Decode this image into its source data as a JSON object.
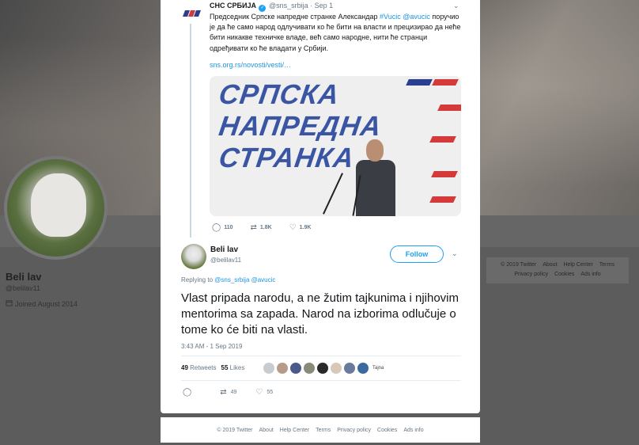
{
  "profile": {
    "name": "Beli lav",
    "handle": "@belilav11",
    "joined": "Joined August 2014"
  },
  "right_footer": {
    "row1": [
      "© 2019 Twitter",
      "About",
      "Help Center",
      "Terms"
    ],
    "row2": [
      "Privacy policy",
      "Cookies",
      "Ads info"
    ]
  },
  "quoted_tweet": {
    "name": "СНС СРБИЈА",
    "handle": "@sns_srbija",
    "separator": "·",
    "date": "Sep 1",
    "text_before": "Председник Српске напредне странке Александар ",
    "hashtag": "#Vucic",
    "mention": "@avucic",
    "text_after": " поручио је да ће само народ одлучивати ко ће бити на власти и прецизирао да неће бити никакве техничке владе, већ само народне, нити ће странци одређивати ко ће владати у Србији.",
    "link": "sns.org.rs/novosti/vesti/…",
    "image_banner": [
      "СРПСКА",
      "НАПРЕДНА",
      "СТРАНКА"
    ],
    "replies": "110",
    "retweets": "1.8K",
    "likes": "1.9K"
  },
  "main_tweet": {
    "name": "Beli lav",
    "handle": "@belilav11",
    "follow_label": "Follow",
    "replying_prefix": "Replying to ",
    "replying_to": "@sns_srbija @avucic",
    "text": "Vlast pripada narodu, a ne žutim tajkunima i njihovim mentorima sa zapada. Narod na izborima odlučuje o tome ko će biti na vlasti.",
    "timestamp": "3:43 AM - 1 Sep 2019",
    "retweet_count": "49",
    "retweet_label": "Retweets",
    "like_count": "55",
    "like_label": "Likes",
    "liker_last_label": "Tajna",
    "action_retweets": "49",
    "action_likes": "55"
  },
  "bottom_footer": [
    "© 2019 Twitter",
    "About",
    "Help Center",
    "Terms",
    "Privacy policy",
    "Cookies",
    "Ads info"
  ],
  "colors": {
    "link": "#1b95e0",
    "accent": "#1da1f2",
    "banner_text": "#3a55a3",
    "stripe_red": "#d43a3a",
    "stripe_blue": "#2a3f8f"
  },
  "icons": [
    "reply-icon",
    "retweet-icon",
    "like-icon",
    "calendar-icon",
    "chevron-down-icon",
    "verified-icon"
  ]
}
